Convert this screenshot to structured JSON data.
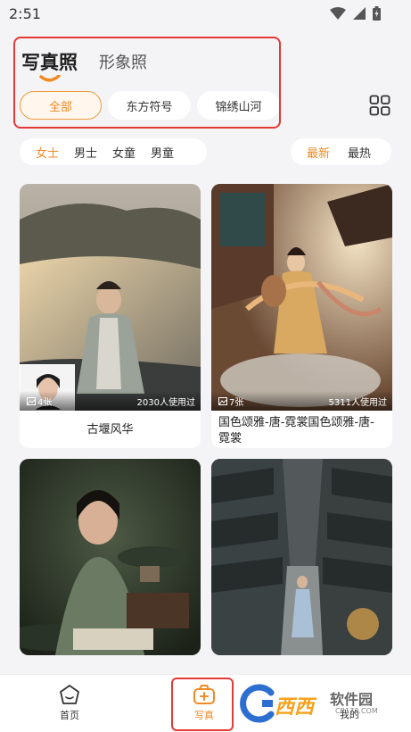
{
  "status_bar": {
    "time": "2:51"
  },
  "top_tabs": {
    "active": "写真照",
    "inactive": "形象照"
  },
  "categories": [
    "全部",
    "东方符号",
    "锦绣山河"
  ],
  "gender_filters": [
    "女士",
    "男士",
    "女童",
    "男童"
  ],
  "sort_options": [
    "最新",
    "最热"
  ],
  "cards": [
    {
      "title": "古堰风华",
      "photos": "4张",
      "usage": "2030人使用过"
    },
    {
      "title": "国色颂雅-唐-霓裳国色颂雅-唐-霓裳",
      "photos": "7张",
      "usage": "5311人使用过"
    },
    {
      "title": "",
      "photos": "",
      "usage": ""
    },
    {
      "title": "",
      "photos": "",
      "usage": ""
    }
  ],
  "nav": {
    "home": "首页",
    "photo": "写真",
    "mine": "我的"
  },
  "watermark": {
    "brand": "西西",
    "site": "软件园",
    "url": "CR173.COM"
  },
  "colors": {
    "accent": "#f08a24",
    "highlight": "#e53935"
  }
}
